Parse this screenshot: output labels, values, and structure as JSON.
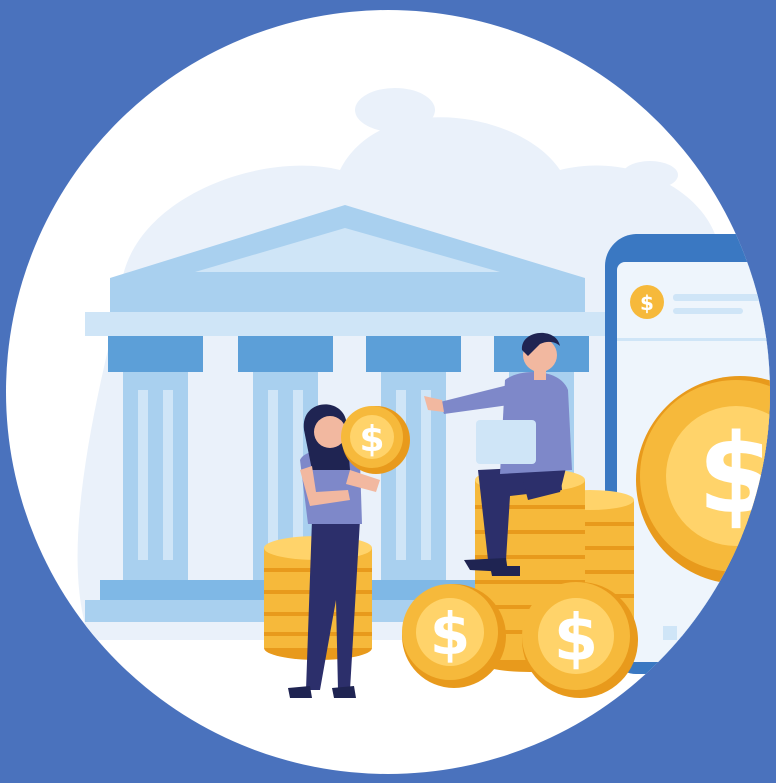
{
  "scene": {
    "colors": {
      "background": "#4a72bd",
      "circle": "#ffffff",
      "blob": "#eaf1fa",
      "bank_light": "#a9d0ef",
      "bank_mid": "#7fb8e6",
      "bank_dark": "#5c9fd8",
      "bank_pale": "#cfe5f7",
      "phone_frame": "#3a78c2",
      "phone_screen": "#eef5fc",
      "coin": "#f6b93b",
      "coin_dark": "#e89a1c",
      "coin_light": "#ffd36a",
      "shirt": "#7e88c9",
      "pants": "#2c2f6b",
      "skin": "#f2b8a0",
      "hair": "#1f2452"
    },
    "icons": [
      "bank-building-icon",
      "smartphone-icon",
      "dollar-coin-icon"
    ]
  }
}
